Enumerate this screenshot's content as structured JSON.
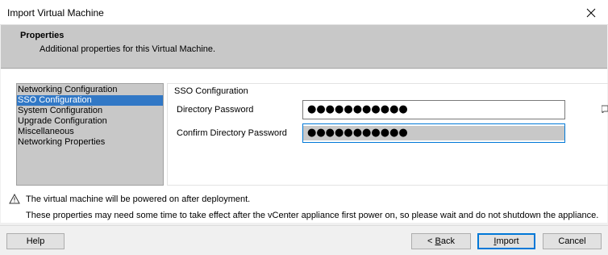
{
  "window": {
    "title": "Import Virtual Machine"
  },
  "header": {
    "title": "Properties",
    "subtitle": "Additional properties for this Virtual Machine."
  },
  "nav": {
    "items": [
      {
        "label": "Networking Configuration",
        "selected": false
      },
      {
        "label": "SSO Configuration",
        "selected": true
      },
      {
        "label": "System Configuration",
        "selected": false
      },
      {
        "label": "Upgrade Configuration",
        "selected": false
      },
      {
        "label": "Miscellaneous",
        "selected": false
      },
      {
        "label": "Networking Properties",
        "selected": false
      }
    ]
  },
  "sso": {
    "group_label": "SSO Configuration",
    "directory_password_label": "Directory Password",
    "directory_password_value": "●●●●●●●●●●●",
    "confirm_password_label": "Confirm Directory Password",
    "confirm_password_value": "●●●●●●●●●●●"
  },
  "notice": {
    "icon": "warning-icon",
    "line1": "The virtual machine will be powered on after deployment.",
    "line2": "These properties may need some time to take effect after the vCenter appliance first power on, so please wait and do not shutdown the appliance."
  },
  "buttons": {
    "help": "Help",
    "back_prefix": "< ",
    "back_mnemonic": "B",
    "back_rest": "ack",
    "import_mnemonic": "I",
    "import_rest": "mport",
    "cancel": "Cancel"
  },
  "colors": {
    "selection": "#3178c6",
    "focus_border": "#0078d7",
    "header_bg": "#c8c8c8"
  }
}
